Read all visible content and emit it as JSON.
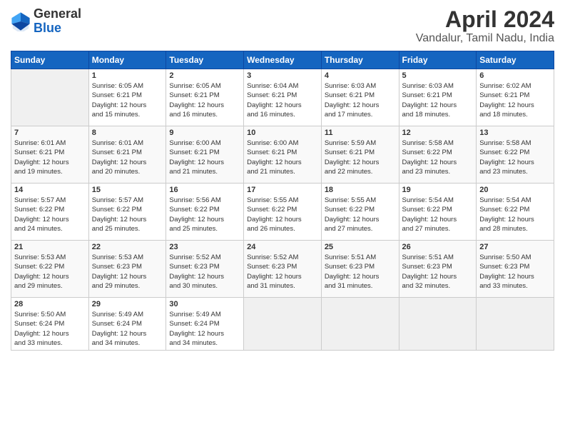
{
  "header": {
    "logo_line1": "General",
    "logo_line2": "Blue",
    "main_title": "April 2024",
    "subtitle": "Vandalur, Tamil Nadu, India"
  },
  "columns": [
    "Sunday",
    "Monday",
    "Tuesday",
    "Wednesday",
    "Thursday",
    "Friday",
    "Saturday"
  ],
  "weeks": [
    [
      {
        "num": "",
        "info": ""
      },
      {
        "num": "1",
        "info": "Sunrise: 6:05 AM\nSunset: 6:21 PM\nDaylight: 12 hours\nand 15 minutes."
      },
      {
        "num": "2",
        "info": "Sunrise: 6:05 AM\nSunset: 6:21 PM\nDaylight: 12 hours\nand 16 minutes."
      },
      {
        "num": "3",
        "info": "Sunrise: 6:04 AM\nSunset: 6:21 PM\nDaylight: 12 hours\nand 16 minutes."
      },
      {
        "num": "4",
        "info": "Sunrise: 6:03 AM\nSunset: 6:21 PM\nDaylight: 12 hours\nand 17 minutes."
      },
      {
        "num": "5",
        "info": "Sunrise: 6:03 AM\nSunset: 6:21 PM\nDaylight: 12 hours\nand 18 minutes."
      },
      {
        "num": "6",
        "info": "Sunrise: 6:02 AM\nSunset: 6:21 PM\nDaylight: 12 hours\nand 18 minutes."
      }
    ],
    [
      {
        "num": "7",
        "info": "Sunrise: 6:01 AM\nSunset: 6:21 PM\nDaylight: 12 hours\nand 19 minutes."
      },
      {
        "num": "8",
        "info": "Sunrise: 6:01 AM\nSunset: 6:21 PM\nDaylight: 12 hours\nand 20 minutes."
      },
      {
        "num": "9",
        "info": "Sunrise: 6:00 AM\nSunset: 6:21 PM\nDaylight: 12 hours\nand 21 minutes."
      },
      {
        "num": "10",
        "info": "Sunrise: 6:00 AM\nSunset: 6:21 PM\nDaylight: 12 hours\nand 21 minutes."
      },
      {
        "num": "11",
        "info": "Sunrise: 5:59 AM\nSunset: 6:21 PM\nDaylight: 12 hours\nand 22 minutes."
      },
      {
        "num": "12",
        "info": "Sunrise: 5:58 AM\nSunset: 6:22 PM\nDaylight: 12 hours\nand 23 minutes."
      },
      {
        "num": "13",
        "info": "Sunrise: 5:58 AM\nSunset: 6:22 PM\nDaylight: 12 hours\nand 23 minutes."
      }
    ],
    [
      {
        "num": "14",
        "info": "Sunrise: 5:57 AM\nSunset: 6:22 PM\nDaylight: 12 hours\nand 24 minutes."
      },
      {
        "num": "15",
        "info": "Sunrise: 5:57 AM\nSunset: 6:22 PM\nDaylight: 12 hours\nand 25 minutes."
      },
      {
        "num": "16",
        "info": "Sunrise: 5:56 AM\nSunset: 6:22 PM\nDaylight: 12 hours\nand 25 minutes."
      },
      {
        "num": "17",
        "info": "Sunrise: 5:55 AM\nSunset: 6:22 PM\nDaylight: 12 hours\nand 26 minutes."
      },
      {
        "num": "18",
        "info": "Sunrise: 5:55 AM\nSunset: 6:22 PM\nDaylight: 12 hours\nand 27 minutes."
      },
      {
        "num": "19",
        "info": "Sunrise: 5:54 AM\nSunset: 6:22 PM\nDaylight: 12 hours\nand 27 minutes."
      },
      {
        "num": "20",
        "info": "Sunrise: 5:54 AM\nSunset: 6:22 PM\nDaylight: 12 hours\nand 28 minutes."
      }
    ],
    [
      {
        "num": "21",
        "info": "Sunrise: 5:53 AM\nSunset: 6:22 PM\nDaylight: 12 hours\nand 29 minutes."
      },
      {
        "num": "22",
        "info": "Sunrise: 5:53 AM\nSunset: 6:23 PM\nDaylight: 12 hours\nand 29 minutes."
      },
      {
        "num": "23",
        "info": "Sunrise: 5:52 AM\nSunset: 6:23 PM\nDaylight: 12 hours\nand 30 minutes."
      },
      {
        "num": "24",
        "info": "Sunrise: 5:52 AM\nSunset: 6:23 PM\nDaylight: 12 hours\nand 31 minutes."
      },
      {
        "num": "25",
        "info": "Sunrise: 5:51 AM\nSunset: 6:23 PM\nDaylight: 12 hours\nand 31 minutes."
      },
      {
        "num": "26",
        "info": "Sunrise: 5:51 AM\nSunset: 6:23 PM\nDaylight: 12 hours\nand 32 minutes."
      },
      {
        "num": "27",
        "info": "Sunrise: 5:50 AM\nSunset: 6:23 PM\nDaylight: 12 hours\nand 33 minutes."
      }
    ],
    [
      {
        "num": "28",
        "info": "Sunrise: 5:50 AM\nSunset: 6:24 PM\nDaylight: 12 hours\nand 33 minutes."
      },
      {
        "num": "29",
        "info": "Sunrise: 5:49 AM\nSunset: 6:24 PM\nDaylight: 12 hours\nand 34 minutes."
      },
      {
        "num": "30",
        "info": "Sunrise: 5:49 AM\nSunset: 6:24 PM\nDaylight: 12 hours\nand 34 minutes."
      },
      {
        "num": "",
        "info": ""
      },
      {
        "num": "",
        "info": ""
      },
      {
        "num": "",
        "info": ""
      },
      {
        "num": "",
        "info": ""
      }
    ]
  ]
}
